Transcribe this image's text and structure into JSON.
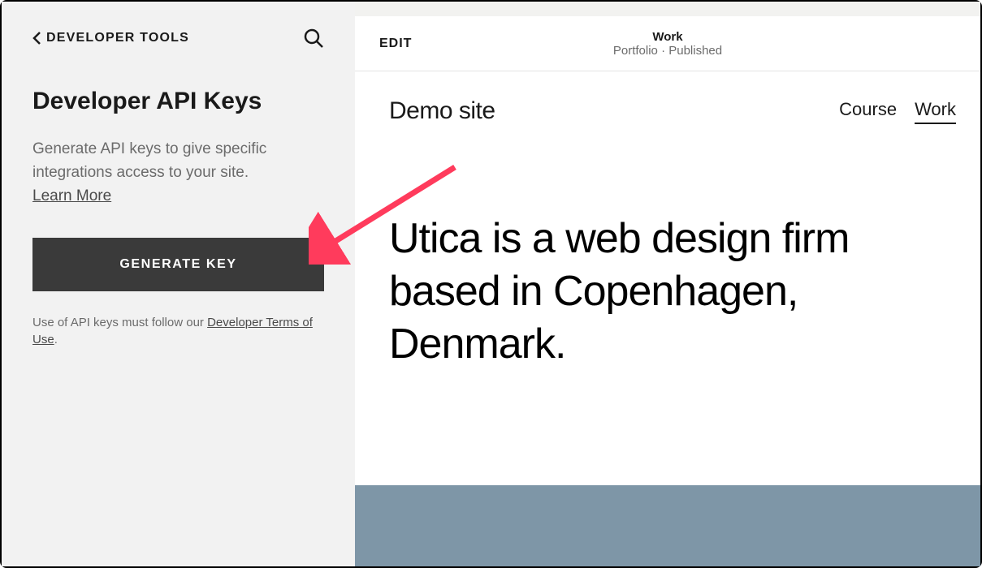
{
  "sidebar": {
    "back_label": "DEVELOPER TOOLS",
    "title": "Developer API Keys",
    "description": "Generate API keys to give specific integrations access to your site.",
    "learn_more": "Learn More",
    "generate_button": "GENERATE KEY",
    "terms_prefix": "Use of API keys must follow our ",
    "terms_link": "Developer Terms of Use",
    "terms_suffix": "."
  },
  "preview": {
    "edit_label": "EDIT",
    "page_name": "Work",
    "page_status": "Portfolio · Published",
    "site_title": "Demo site",
    "nav_items": [
      "Course",
      "Work"
    ],
    "active_nav_index": 1,
    "hero_text": "Utica is a web design firm based in Copenhagen, Denmark."
  },
  "annotation": {
    "arrow_color": "#ff3b5c"
  }
}
